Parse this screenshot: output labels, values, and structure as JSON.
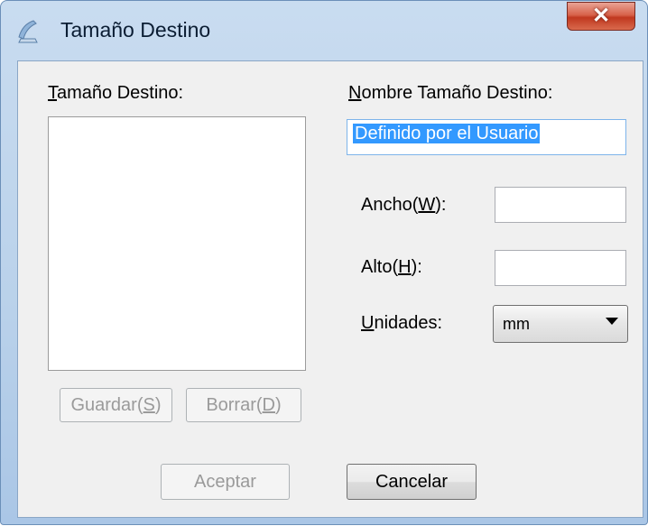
{
  "window": {
    "title": "Tamaño Destino"
  },
  "left_panel": {
    "label_mnemonic": "T",
    "label_rest": "amaño Destino:"
  },
  "name_section": {
    "label_mnemonic": "N",
    "label_rest": "ombre Tamaño Destino:",
    "value": "Definido por el Usuario"
  },
  "width": {
    "label_prefix": "Ancho(",
    "label_mnemonic": "W",
    "label_suffix": "):",
    "value": ""
  },
  "height": {
    "label_prefix": "Alto(",
    "label_mnemonic": "H",
    "label_suffix": "):",
    "value": ""
  },
  "units": {
    "label_mnemonic": "U",
    "label_rest": "nidades:",
    "selected": "mm"
  },
  "buttons": {
    "save": {
      "prefix": "Guardar(",
      "mnemonic": "S",
      "suffix": ")"
    },
    "delete": {
      "prefix": "Borrar(",
      "mnemonic": "D",
      "suffix": ")"
    },
    "ok": "Aceptar",
    "cancel": "Cancelar"
  },
  "icons": {
    "app": "scanner-app-icon",
    "close": "close-icon",
    "dropdown": "chevron-down-icon"
  }
}
